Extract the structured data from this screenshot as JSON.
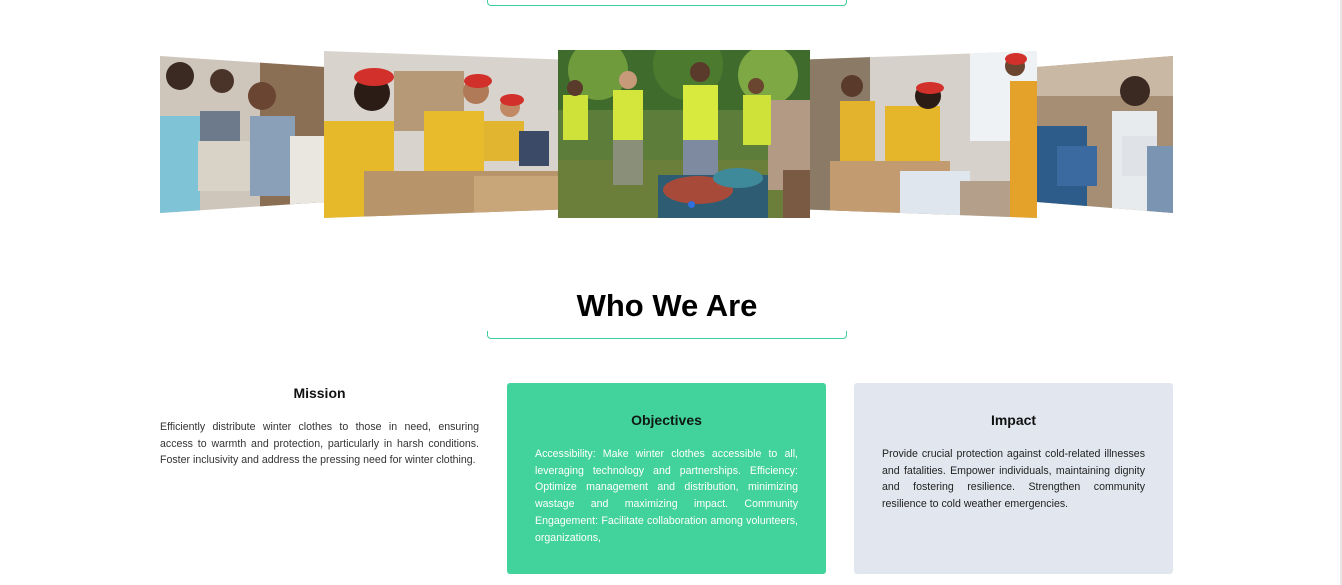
{
  "carousel": {
    "images": [
      {
        "alt": "volunteers sorting donated clothes"
      },
      {
        "alt": "volunteer in red cap packing boxes"
      },
      {
        "alt": "volunteers in safety vests outdoors"
      },
      {
        "alt": "volunteers handing out supplies"
      },
      {
        "alt": "volunteer holding donated clothes"
      }
    ],
    "active_index": 2
  },
  "section": {
    "title": "Who We Are"
  },
  "cards": {
    "mission": {
      "title": "Mission",
      "text": "Efficiently distribute winter clothes to those in need, ensuring access to warmth and protection, particularly in harsh conditions. Foster inclusivity and address the pressing need for winter clothing."
    },
    "objectives": {
      "title": "Objectives",
      "text": "Accessibility: Make winter clothes accessible to all, leveraging technology and partnerships. Efficiency: Optimize management and distribution, minimizing wastage and maximizing impact. Community Engagement: Facilitate collaboration among volunteers, organizations,"
    },
    "impact": {
      "title": "Impact",
      "text": "Provide crucial protection against cold-related illnesses and fatalities. Empower individuals, maintaining dignity and fostering resilience. Strengthen community resilience to cold weather emergencies."
    }
  },
  "colors": {
    "accent": "#42d29b",
    "divider": "#3ecf98",
    "impact_bg": "#e2e7ef",
    "carousel_dot": "#2f6fde"
  }
}
